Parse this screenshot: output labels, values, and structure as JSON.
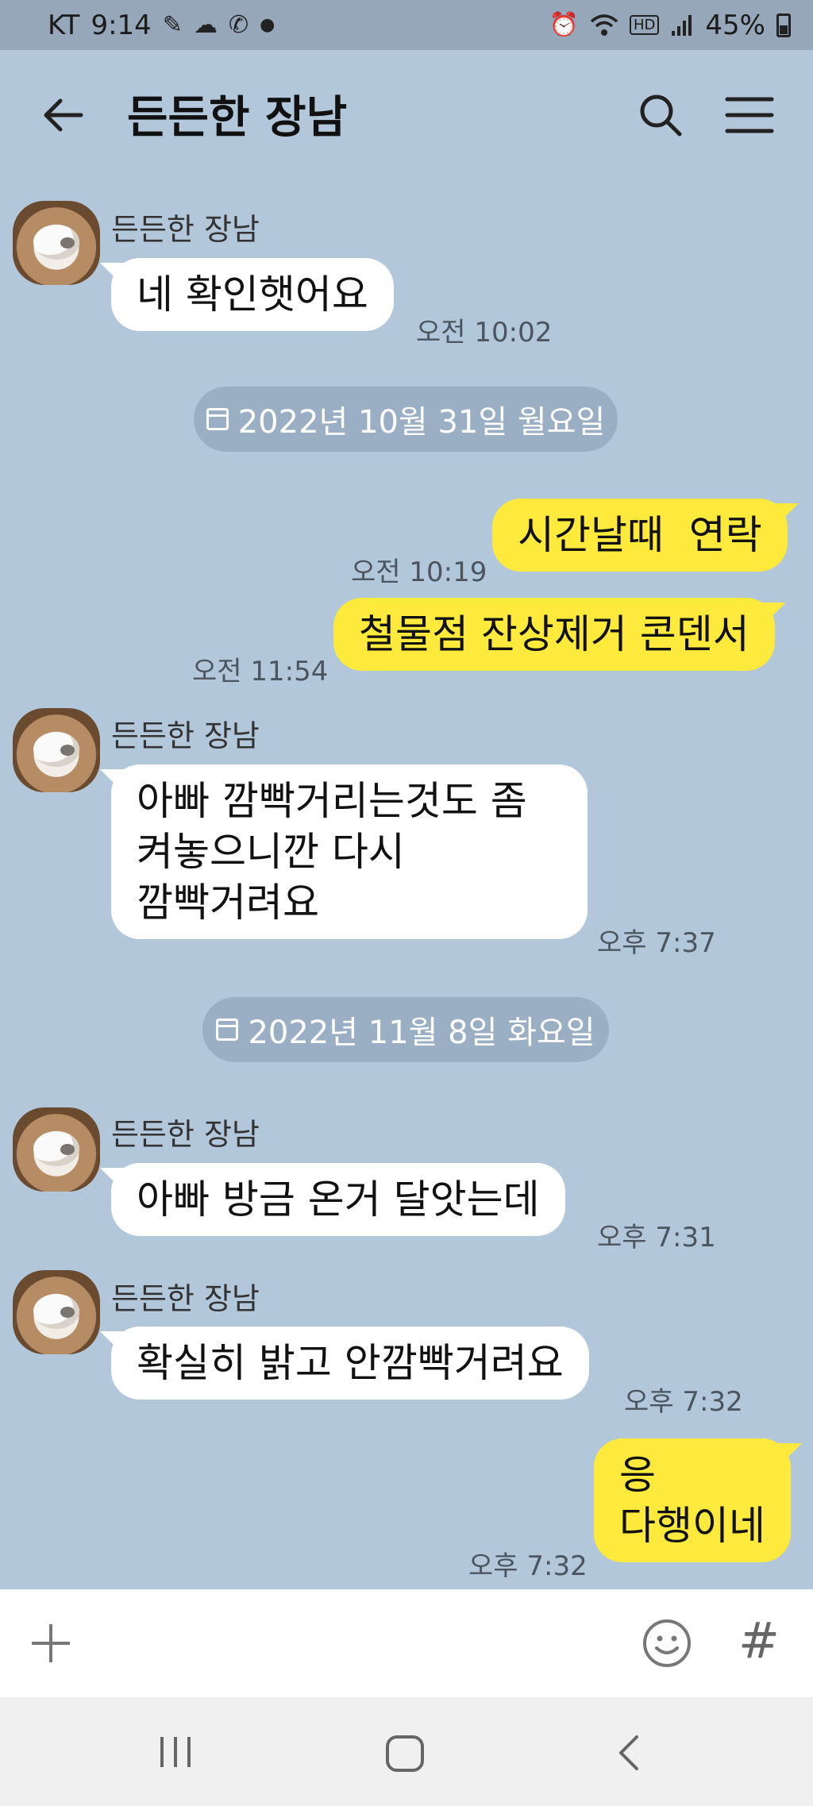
{
  "status_bar": {
    "carrier": "KT",
    "time": "9:14",
    "network_badge": "HD",
    "battery": "45%"
  },
  "header": {
    "title": "든든한 장남"
  },
  "messages": [
    {
      "sender": "든든한 장남",
      "text": "네 확인햇어요",
      "time": "오전 10:02"
    },
    {
      "date": "2022년 10월 31일 월요일"
    },
    {
      "text": "시간날때  연락",
      "time": "오전 10:19"
    },
    {
      "text": "철물점 잔상제거 콘덴서",
      "time": "오전 11:54"
    },
    {
      "sender": "든든한 장남",
      "text": "아빠 깜빡거리는것도 좀\n켜놓으니깐 다시\n깜빡거려요",
      "time": "오후 7:37"
    },
    {
      "date": "2022년 11월 8일 화요일"
    },
    {
      "sender": "든든한 장남",
      "text": "아빠 방금 온거 달앗는데",
      "time": "오후 7:31"
    },
    {
      "sender": "든든한 장남",
      "text": "확실히 밝고 안깜빡거려요",
      "time": "오후 7:32"
    },
    {
      "text": "응\n다행이네",
      "time": "오후 7:32"
    }
  ],
  "input_bar": {
    "hash_label": "#"
  },
  "colors": {
    "chat_background": "#b2c7da",
    "my_bubble": "#fee93d",
    "their_bubble": "#ffffff",
    "date_pill": "#9aafc3"
  },
  "icons": [
    "back-arrow-icon",
    "search-icon",
    "menu-icon",
    "plus-icon",
    "emoji-icon",
    "calendar-icon",
    "recent-apps-icon",
    "home-icon",
    "nav-back-icon"
  ]
}
